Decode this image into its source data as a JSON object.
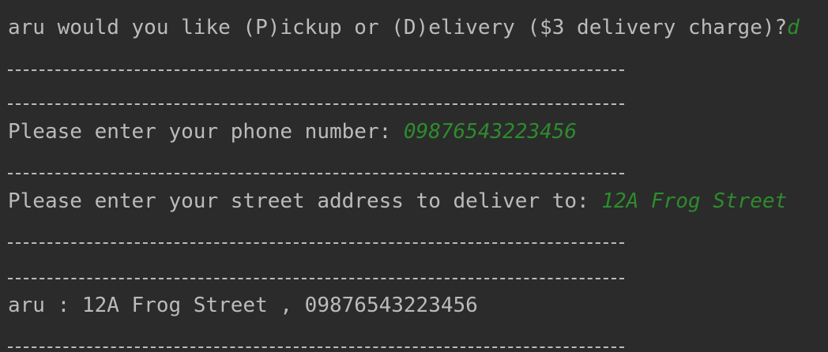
{
  "console": {
    "delivery_prompt": "aru would you like (P)ickup or (D)elivery ($3 delivery charge)?",
    "delivery_input": "d",
    "phone_prompt": "Please enter your phone number: ",
    "phone_input": "09876543223456",
    "address_prompt": "Please enter your street address to deliver to: ",
    "address_input": "12A Frog Street",
    "summary": "aru : 12A Frog Street , 09876543223456"
  },
  "colors": {
    "background": "#2b2b2b",
    "output_text": "#bbbbbb",
    "user_input": "#2e8b2e"
  }
}
